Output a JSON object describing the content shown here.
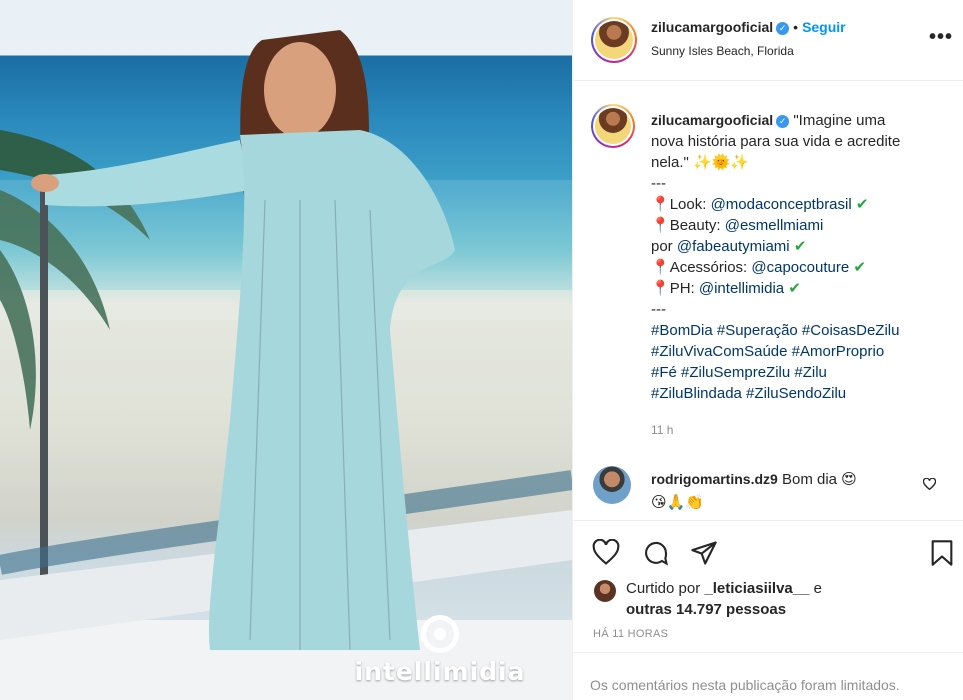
{
  "post": {
    "image_watermark": "intellimidia"
  },
  "header": {
    "username": "zilucamargooficial",
    "dot": "•",
    "follow_label": "Seguir",
    "location": "Sunny Isles Beach, Florida",
    "more_icon": "more-options-icon",
    "verified_icon": "verified-badge-icon"
  },
  "caption": {
    "username": "zilucamargooficial",
    "quote_1": "\"Imagine uma",
    "quote_2": "nova história para sua vida e acredite",
    "quote_3": "nela.\"",
    "quote_emoji": "✨🌞✨",
    "sep_1": "---",
    "look_label": "Look: ",
    "look_link": "@modaconceptbrasil",
    "beauty_label": "Beauty: ",
    "beauty_link": "@esmellmiami",
    "por_label": "por ",
    "por_link": "@fabeautymiami",
    "acc_label": "Acessórios: ",
    "acc_link": "@capocouture",
    "ph_label": "PH: ",
    "ph_link": "@intellimidia",
    "sep_2": "---",
    "hashtags_1": "#BomDia #Superação #CoisasDeZilu",
    "hashtags_2": "#ZiluVivaComSaúde #AmorProprio",
    "hashtags_3": "#Fé #ZiluSempreZilu #Zilu",
    "hashtags_4": "#ZiluBlindada #ZiluSendoZilu",
    "time": "11 h",
    "pin_emoji": "📍",
    "check_emoji": "✔"
  },
  "comment": {
    "username": "rodrigomartins.dz9",
    "text": "Bom dia",
    "emoji_1": "😍",
    "emoji_2": "😘🙏👏"
  },
  "likes": {
    "prefix": "Curtido por ",
    "liker": "_leticiasiilva__",
    "joiner": " e",
    "others": "outras 14.797 pessoas"
  },
  "timestamp": "HÁ 11 HORAS",
  "footer": {
    "limited_text": "Os comentários nesta publicação foram limitados."
  },
  "colors": {
    "link": "#00376b",
    "follow": "#0095f6",
    "muted": "#8e8e8e",
    "verified": "#3897f0"
  }
}
